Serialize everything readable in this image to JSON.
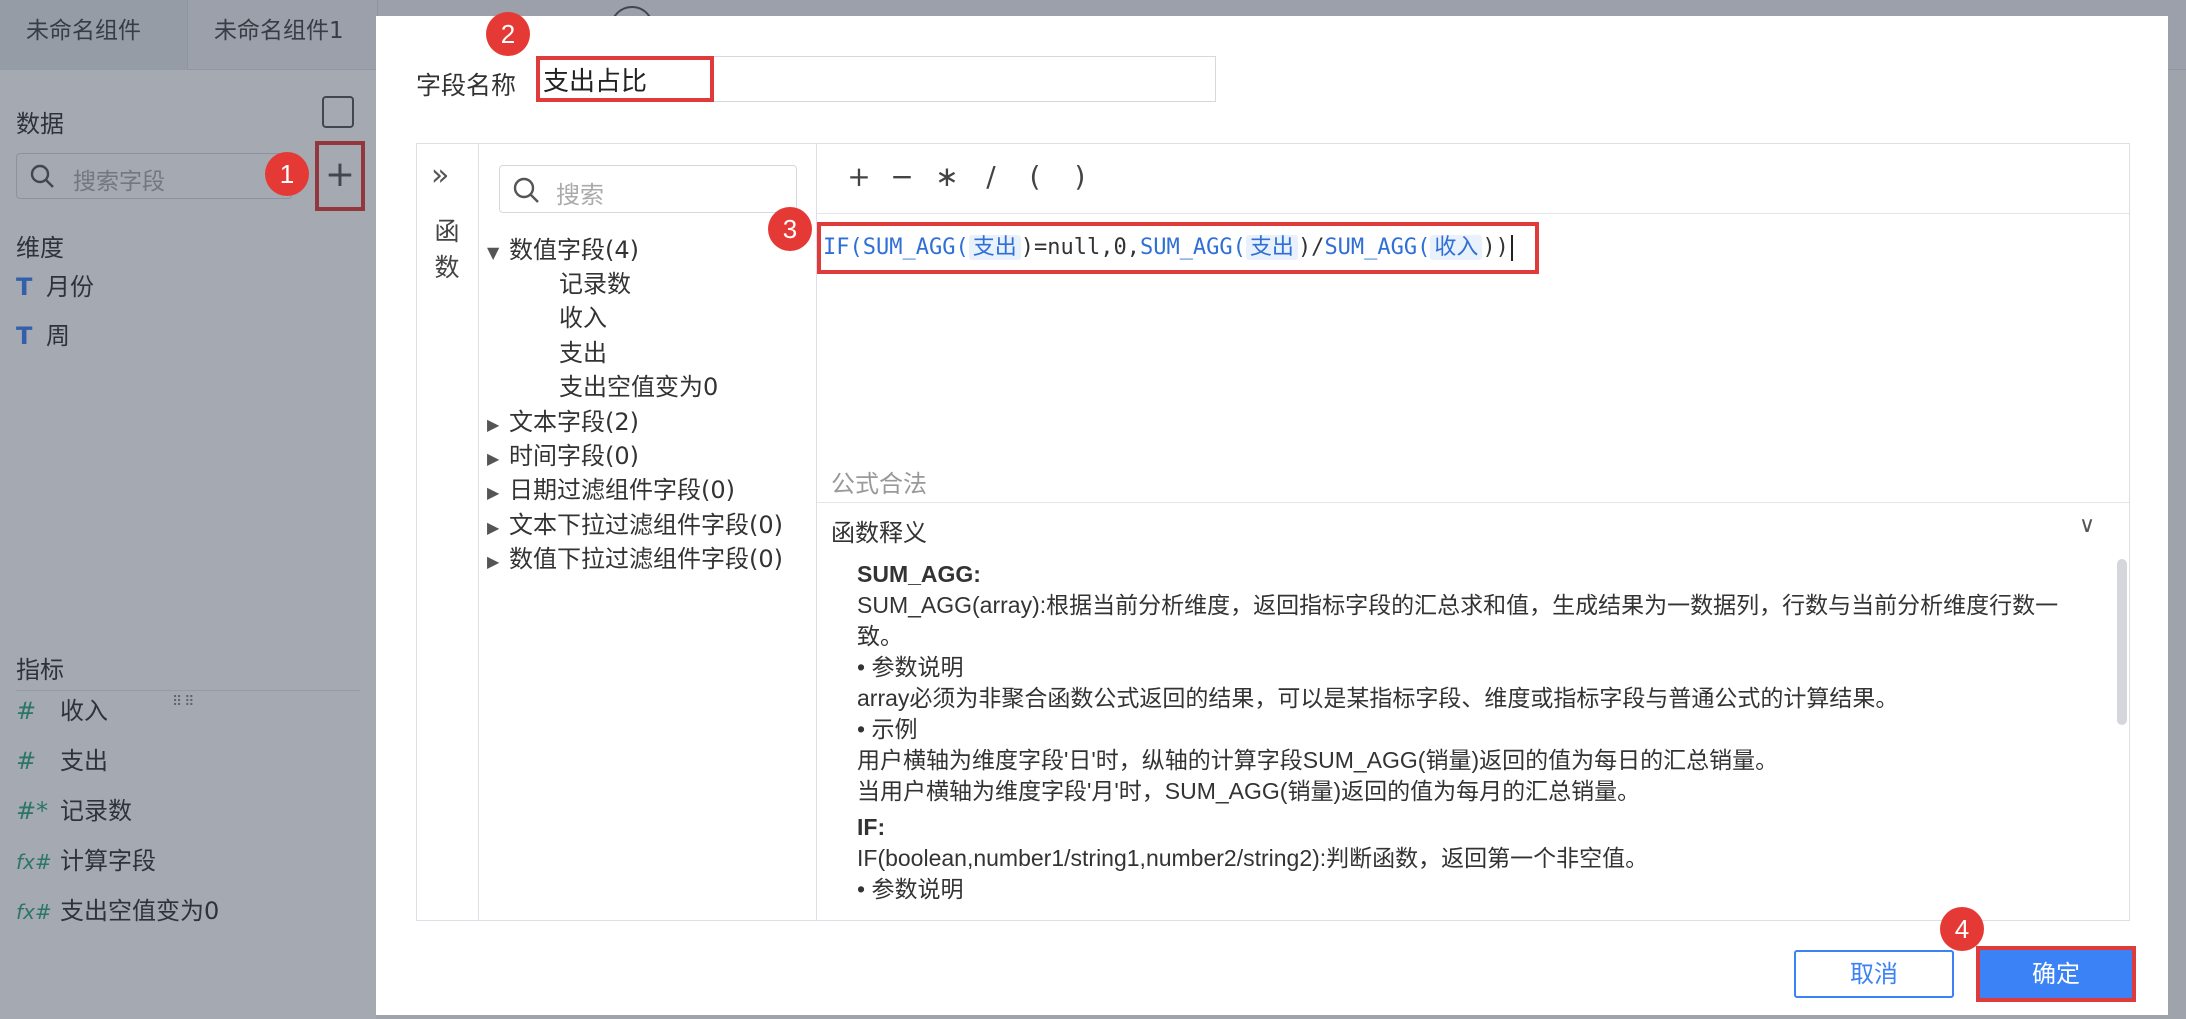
{
  "tabs": [
    {
      "label": "未命名组件"
    },
    {
      "label": "未命名组件1"
    }
  ],
  "sidebar": {
    "data_title": "数据",
    "search_placeholder": "搜索字段",
    "add_symbol": "+",
    "dimension_title": "维度",
    "dimensions": [
      {
        "icon": "T",
        "label": "月份"
      },
      {
        "icon": "T",
        "label": "周"
      }
    ],
    "grip": "⠿⠿",
    "measure_title": "指标",
    "measures": [
      {
        "icon": "#",
        "label": "收入"
      },
      {
        "icon": "#",
        "label": "支出"
      },
      {
        "icon": "#*",
        "label": "记录数"
      },
      {
        "icon": "fx#",
        "label": "计算字段"
      },
      {
        "icon": "fx#",
        "label": "支出空值变为0"
      }
    ]
  },
  "badges": {
    "b1": "1",
    "b2": "2",
    "b3": "3",
    "b4": "4"
  },
  "dialog": {
    "field_name_label": "字段名称",
    "field_name_value": "支出占比",
    "rail_chevron": "»",
    "rail_label": "函数",
    "field_search_placeholder": "搜索",
    "groups": [
      {
        "arrow": "▼",
        "label": "数值字段(4)"
      },
      {
        "arrow": "▶",
        "label": "文本字段(2)"
      },
      {
        "arrow": "▶",
        "label": "时间字段(0)"
      },
      {
        "arrow": "▶",
        "label": "日期过滤组件字段(0)"
      },
      {
        "arrow": "▶",
        "label": "文本下拉过滤组件字段(0)"
      },
      {
        "arrow": "▶",
        "label": "数值下拉过滤组件字段(0)"
      }
    ],
    "numeric_fields": [
      "记录数",
      "收入",
      "支出",
      "支出空值变为0"
    ],
    "operators": [
      "+",
      "−",
      "∗",
      "/",
      "(",
      ")"
    ],
    "formula": {
      "p1": "IF(",
      "p2": "SUM_AGG(",
      "t1": "支出",
      "p3": ")=null,0,",
      "p4": "SUM_AGG(",
      "t2": "支出",
      "p5": ")/",
      "p6": "SUM_AGG(",
      "t3": "收入",
      "p7": "))"
    },
    "validation": "公式合法",
    "explain_title": "函数释义",
    "explain_chevron": "∨",
    "explain": {
      "f1_name": "SUM_AGG:",
      "f1_desc": "SUM_AGG(array):根据当前分析维度，返回指标字段的汇总求和值，生成结果为一数据列，行数与当前分析维度行数一致。",
      "f1_param_title": "• 参数说明",
      "f1_param": "array必须为非聚合函数公式返回的结果，可以是某指标字段、维度或指标字段与普通公式的计算结果。",
      "f1_example_title": "• 示例",
      "f1_example1": "用户横轴为维度字段'日'时，纵轴的计算字段SUM_AGG(销量)返回的值为每日的汇总销量。",
      "f1_example2": "当用户横轴为维度字段'月'时，SUM_AGG(销量)返回的值为每月的汇总销量。",
      "f2_name": "IF:",
      "f2_desc": "IF(boolean,number1/string1,number2/string2):判断函数，返回第一个非空值。",
      "f2_param_title": "• 参数说明"
    },
    "cancel_label": "取消",
    "ok_label": "确定"
  }
}
